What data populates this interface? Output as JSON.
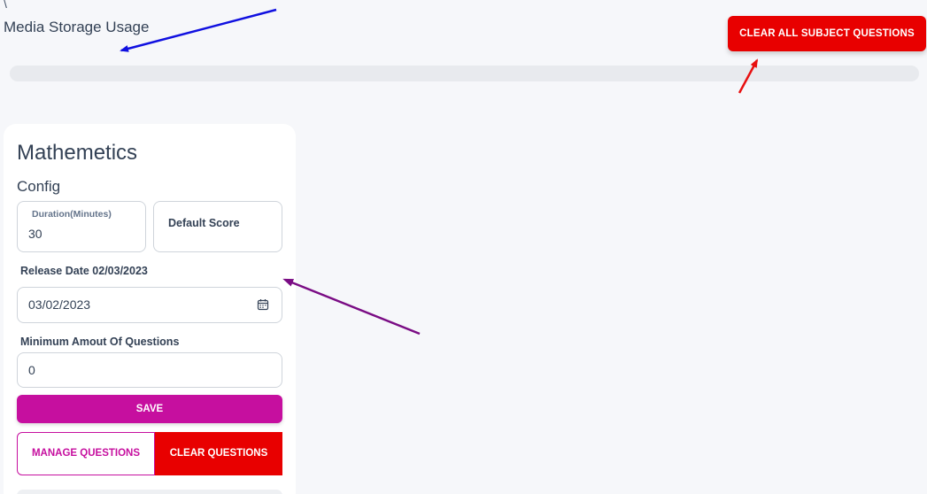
{
  "header": {
    "breadcrumb_mark": "\\",
    "storage_title": "Media Storage Usage",
    "storage_usage": 0,
    "clear_all_label": "CLEAR ALL SUBJECT QUESTIONS"
  },
  "subject": {
    "title": "Mathemetics",
    "config_title": "Config",
    "duration": {
      "label": "Duration(Minutes)",
      "value": "30"
    },
    "default_score": {
      "label": "Default Score",
      "value": ""
    },
    "release_date": {
      "label": "Release Date 02/03/2023",
      "value": "03/02/2023"
    },
    "min_questions": {
      "label": "Minimum Amout Of Questions",
      "value": "0"
    },
    "save_label": "SAVE",
    "manage_label": "MANAGE QUESTIONS",
    "clear_label": "CLEAR QUESTIONS"
  },
  "colors": {
    "danger": "#e80000",
    "accent": "#c60f9f",
    "arrow_blue": "#1010e0",
    "arrow_red": "#e81010",
    "arrow_purple": "#7a0c84"
  },
  "icons": {
    "date_picker": "calendar-icon"
  }
}
